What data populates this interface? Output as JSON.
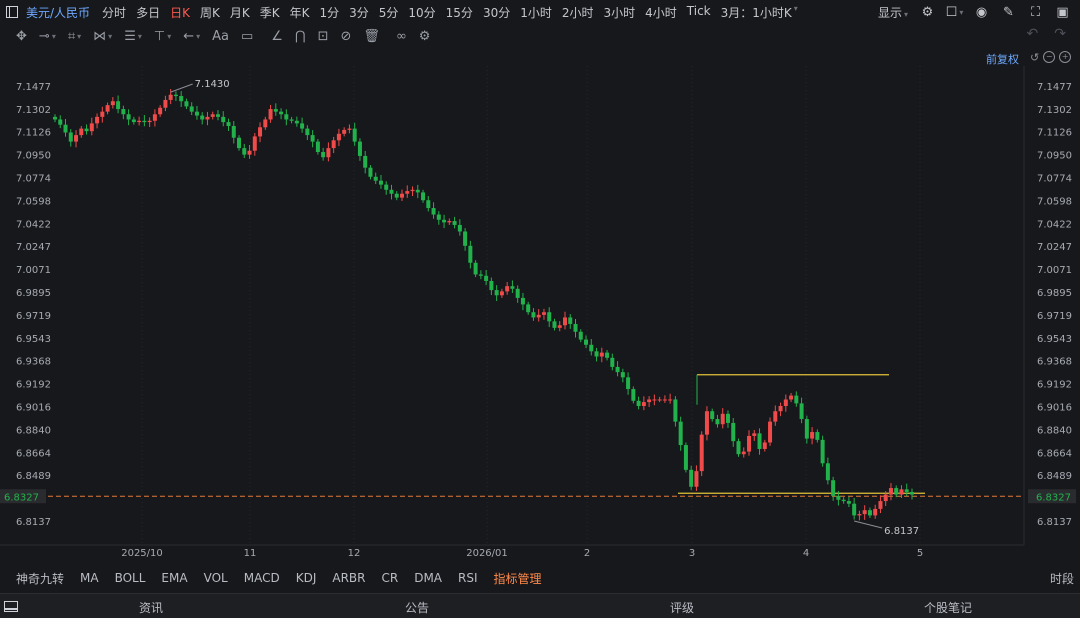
{
  "header": {
    "pair": "美元/人民币",
    "periods": [
      "分时",
      "多日",
      "日K",
      "周K",
      "月K",
      "季K",
      "年K",
      "1分",
      "3分",
      "5分",
      "10分",
      "15分",
      "30分",
      "1小时",
      "2小时",
      "3小时",
      "4小时",
      "Tick",
      "3月：1小时K"
    ],
    "active_period": "日K",
    "display_label": "显示"
  },
  "toolbar": {
    "icons": [
      "move-icon",
      "line-tool-icon",
      "rect-tool-icon",
      "pattern-tool-icon",
      "fib-tool-icon",
      "level-tool-icon",
      "arrow-tool-icon",
      "text-tool-icon",
      "comment-tool-icon",
      "eraser-icon",
      "magnet-icon",
      "lock-icon",
      "hide-icon",
      "delete-icon",
      "link-icon",
      "settings-icon"
    ]
  },
  "fuquan_label": "前复权",
  "chart_data": {
    "type": "candlestick",
    "title": "",
    "y_ticks": [
      "7.1477",
      "7.1302",
      "7.1126",
      "7.0950",
      "7.0774",
      "7.0598",
      "7.0422",
      "7.0247",
      "7.0071",
      "6.9895",
      "6.9719",
      "6.9543",
      "6.9368",
      "6.9192",
      "6.9016",
      "6.8840",
      "6.8664",
      "6.8489",
      "6.8137"
    ],
    "ylim": [
      6.8,
      7.16
    ],
    "x_labels": [
      "2025/10",
      "11",
      "12",
      "2026/01",
      "2",
      "3",
      "4",
      "5"
    ],
    "current_price": "6.8327",
    "current_price_value": 6.8327,
    "high_label": "7.1430",
    "high_value": 7.143,
    "low_label": "6.8137",
    "low_value": 6.8137,
    "up_color": "#f04a4a",
    "down_color": "#22b24c",
    "box": {
      "top": 6.926,
      "bottom": 6.835,
      "label": ""
    },
    "closes": [
      7.122,
      7.118,
      7.112,
      7.105,
      7.11,
      7.115,
      7.113,
      7.119,
      7.124,
      7.128,
      7.133,
      7.136,
      7.13,
      7.126,
      7.122,
      7.12,
      7.121,
      7.12,
      7.121,
      7.126,
      7.131,
      7.137,
      7.141,
      7.14,
      7.136,
      7.132,
      7.128,
      7.125,
      7.122,
      7.124,
      7.126,
      7.124,
      7.12,
      7.117,
      7.108,
      7.1,
      7.095,
      7.098,
      7.109,
      7.116,
      7.122,
      7.13,
      7.128,
      7.126,
      7.122,
      7.121,
      7.119,
      7.115,
      7.11,
      7.105,
      7.097,
      7.093,
      7.1,
      7.106,
      7.111,
      7.114,
      7.115,
      7.105,
      7.094,
      7.085,
      7.078,
      7.075,
      7.072,
      7.068,
      7.065,
      7.062,
      7.065,
      7.067,
      7.068,
      7.066,
      7.06,
      7.054,
      7.049,
      7.045,
      7.043,
      7.044,
      7.041,
      7.036,
      7.025,
      7.012,
      7.003,
      7.002,
      6.998,
      6.991,
      6.987,
      6.99,
      6.994,
      6.992,
      6.985,
      6.98,
      6.974,
      6.97,
      6.972,
      6.974,
      6.967,
      6.962,
      6.964,
      6.97,
      6.965,
      6.959,
      6.953,
      6.949,
      6.944,
      6.94,
      6.943,
      6.939,
      6.932,
      6.928,
      6.924,
      6.915,
      6.906,
      6.902,
      6.905,
      6.907,
      6.907,
      6.907,
      6.907,
      6.907,
      6.89,
      6.872,
      6.853,
      6.84,
      6.852,
      6.88,
      6.898,
      6.892,
      6.888,
      6.896,
      6.889,
      6.875,
      6.865,
      6.867,
      6.879,
      6.881,
      6.869,
      6.874,
      6.89,
      6.898,
      6.902,
      6.907,
      6.91,
      6.904,
      6.892,
      6.877,
      6.882,
      6.876,
      6.858,
      6.845,
      6.833,
      6.83,
      6.829,
      6.827,
      6.818,
      6.819,
      6.822,
      6.818,
      6.823,
      6.829,
      6.834,
      6.839,
      6.834,
      6.838,
      6.836,
      6.834
    ]
  },
  "indicators": [
    "神奇九转",
    "MA",
    "BOLL",
    "EMA",
    "VOL",
    "MACD",
    "KDJ",
    "ARBR",
    "CR",
    "DMA",
    "RSI",
    "指标管理"
  ],
  "active_indicator": "指标管理",
  "shiduan_label": "时段",
  "footer": {
    "tabs": [
      "资讯",
      "公告",
      "评级",
      "个股笔记"
    ]
  }
}
